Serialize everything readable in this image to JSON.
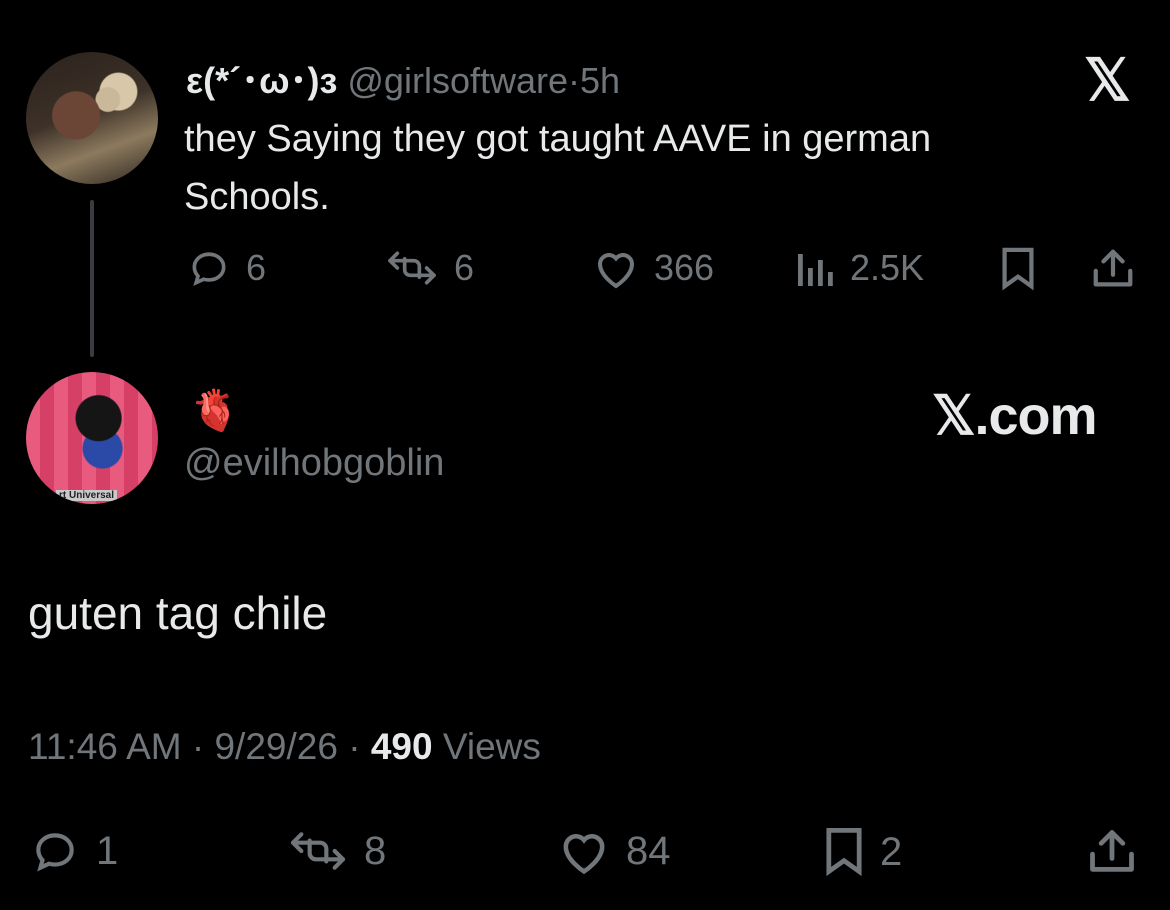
{
  "top_tweet": {
    "display_name": "ε(*´･ω･)з",
    "handle": "@girlsoftware",
    "separator": "·",
    "time": "5h",
    "text": "they Saying they got taught AAVE in german Schools.",
    "replies": "6",
    "reposts": "6",
    "likes": "366",
    "views": "2.5K",
    "logo": "𝕏"
  },
  "reply_tweet": {
    "emoji": "🫀",
    "handle": "@evilhobgoblin",
    "brand": "𝕏.com",
    "avatar_caption": "rt Universal",
    "text": "guten tag chile",
    "time": "11:46 AM",
    "date": "9/29/26",
    "views_count": "490",
    "views_label": "Views",
    "replies": "1",
    "reposts": "8",
    "likes": "84",
    "bookmarks": "2"
  },
  "colors": {
    "background": "#000000",
    "text_primary": "#e7e9ea",
    "text_secondary": "#71767b",
    "thread_line": "#3a3c3f"
  },
  "icons": [
    "reply-icon",
    "repost-icon",
    "like-icon",
    "views-icon",
    "bookmark-icon",
    "share-icon",
    "x-logo"
  ]
}
